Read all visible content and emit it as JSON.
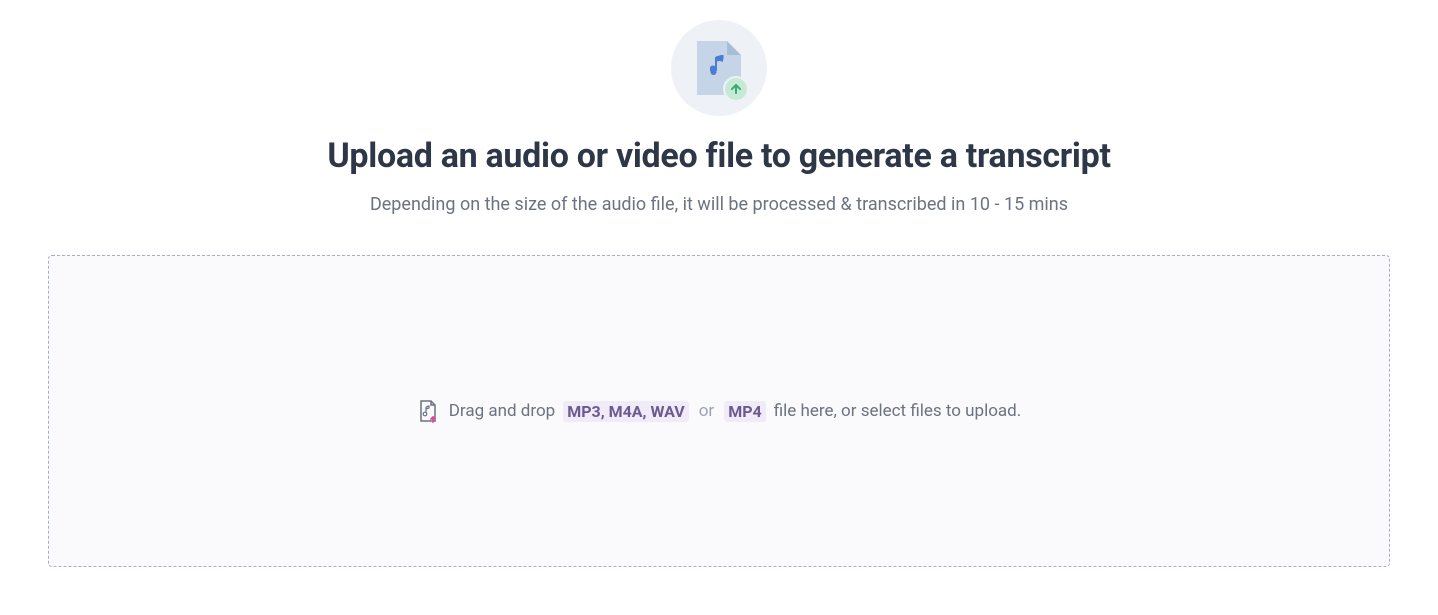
{
  "header": {
    "title": "Upload an audio or video file to generate a transcript",
    "subtitle": "Depending on the size of the audio file, it will be processed & transcribed in 10 - 15 mins"
  },
  "dropzone": {
    "drag_prefix": "Drag and drop",
    "audio_formats": "MP3, M4A, WAV",
    "or_text": "or",
    "video_formats": "MP4",
    "drag_suffix": "file here, or select files to upload."
  },
  "icons": {
    "hero": "audio-file-upload-icon",
    "dropzone_file": "file-upload-icon"
  },
  "colors": {
    "accent_purple": "#6b5a8f",
    "badge_bg": "#f0ebf7",
    "border_dash": "#a5a9e0",
    "dropzone_bg": "#fafafd",
    "text_dark": "#2d3748",
    "text_muted": "#6b7280"
  }
}
